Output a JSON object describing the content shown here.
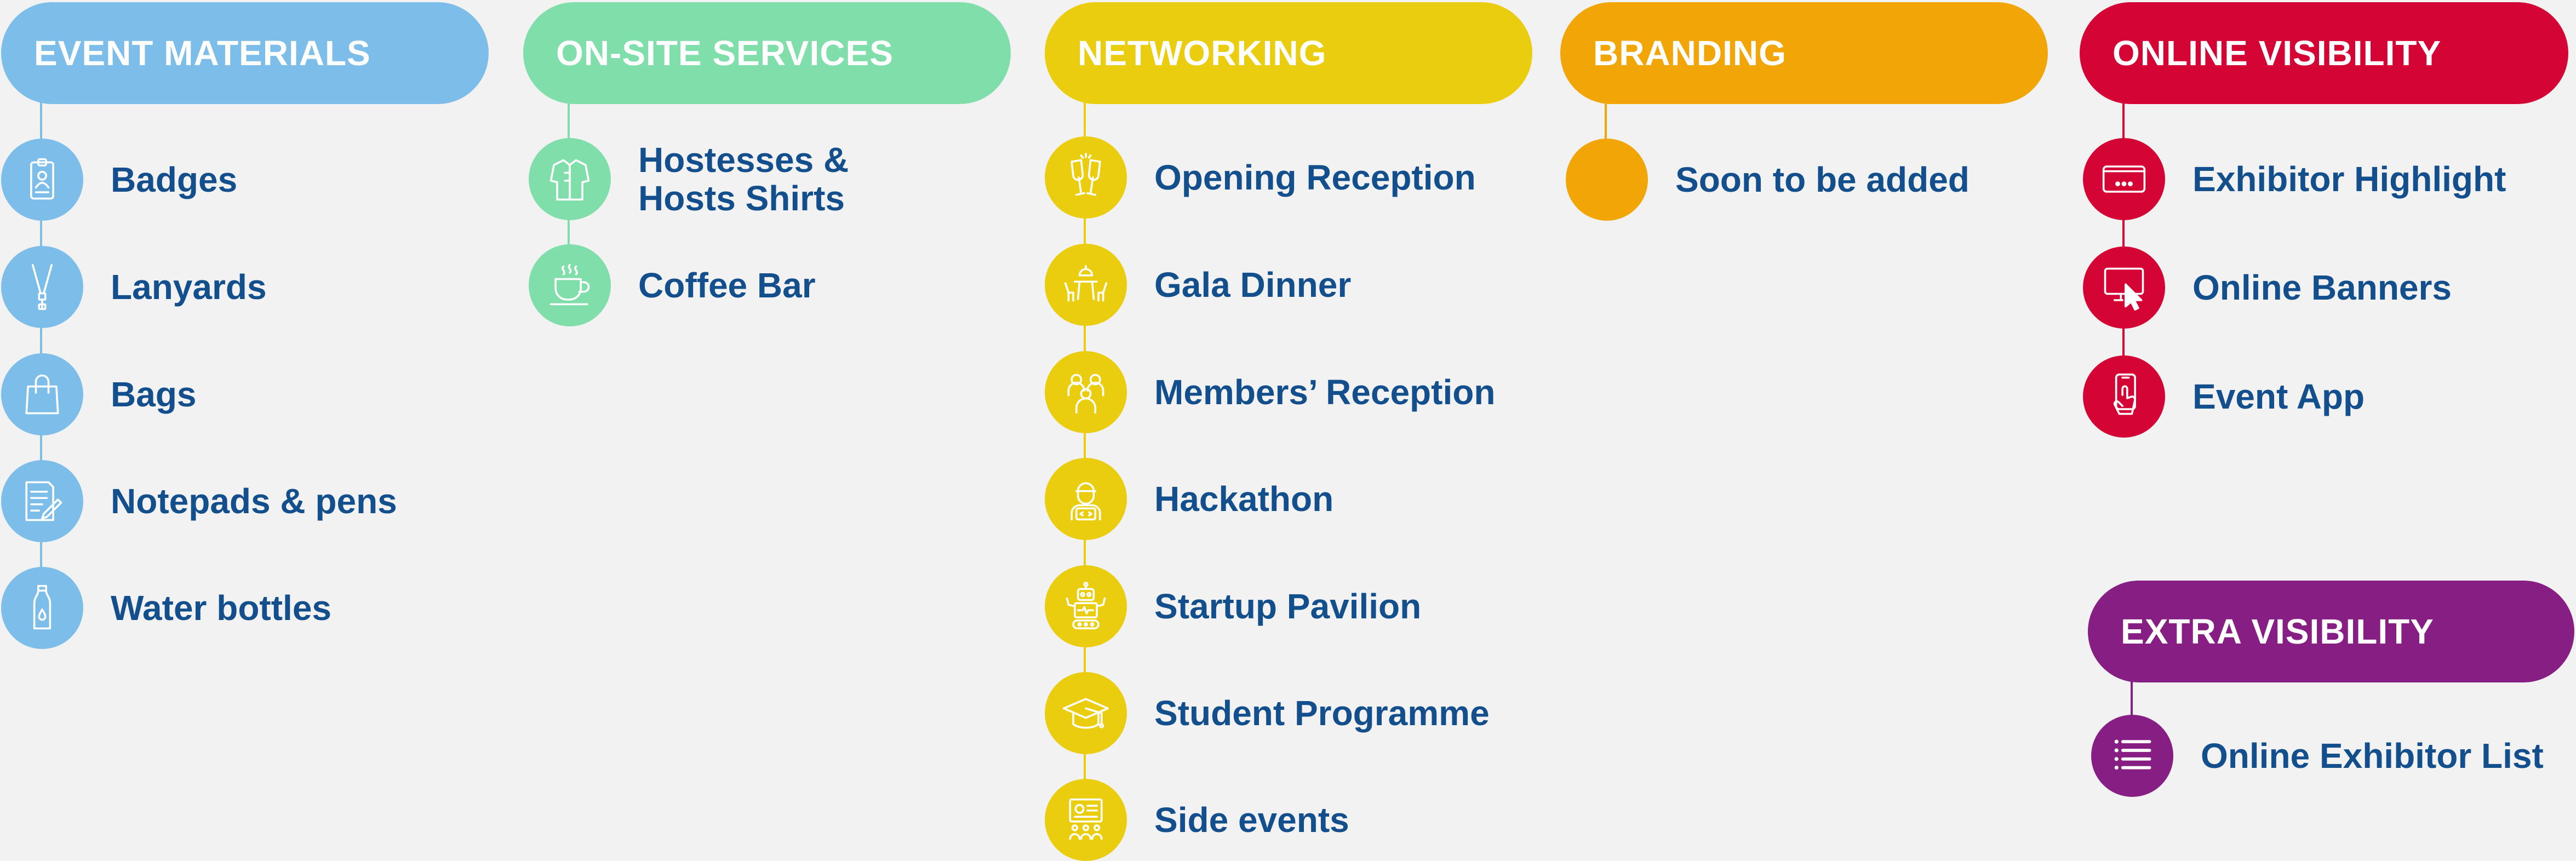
{
  "colors": {
    "event_materials": "#7dbde9",
    "on_site_services": "#80deab",
    "networking": "#ebcd10",
    "branding": "#f1a507",
    "online_visibility": "#d40535",
    "extra_visibility": "#861e83",
    "label_text": "#134f8c",
    "background": "#f2f2f2"
  },
  "event_materials": {
    "title": "EVENT MATERIALS",
    "items": [
      {
        "label": "Badges",
        "icon": "badge-icon"
      },
      {
        "label": "Lanyards",
        "icon": "lanyard-icon"
      },
      {
        "label": "Bags",
        "icon": "bag-icon"
      },
      {
        "label": "Notepads & pens",
        "icon": "notepad-pen-icon"
      },
      {
        "label": "Water bottles",
        "icon": "water-bottle-icon"
      }
    ]
  },
  "on_site_services": {
    "title": "ON-SITE SERVICES",
    "items": [
      {
        "label_line1": "Hostesses &",
        "label_line2": "Hosts Shirts",
        "icon": "shirt-icon"
      },
      {
        "label": "Coffee Bar",
        "icon": "coffee-cup-icon"
      }
    ]
  },
  "networking": {
    "title": "NETWORKING",
    "items": [
      {
        "label": "Opening Reception",
        "icon": "champagne-glasses-icon"
      },
      {
        "label": "Gala Dinner",
        "icon": "dinner-table-icon"
      },
      {
        "label": "Members’ Reception",
        "icon": "people-group-icon"
      },
      {
        "label": "Hackathon",
        "icon": "coder-icon"
      },
      {
        "label": "Startup Pavilion",
        "icon": "robot-icon"
      },
      {
        "label": "Student Programme",
        "icon": "graduation-cap-icon"
      },
      {
        "label": "Side events",
        "icon": "presentation-icon"
      }
    ]
  },
  "branding": {
    "title": "BRANDING",
    "items": [
      {
        "label": "Soon to be added"
      }
    ]
  },
  "online_visibility": {
    "title": "ONLINE VISIBILITY",
    "items": [
      {
        "label": "Exhibitor Highlight",
        "icon": "screen-dots-icon"
      },
      {
        "label": "Online Banners",
        "icon": "monitor-cursor-icon"
      },
      {
        "label": "Event App",
        "icon": "phone-tap-icon"
      }
    ]
  },
  "extra_visibility": {
    "title": "EXTRA VISIBILITY",
    "items": [
      {
        "label": "Online Exhibitor List",
        "icon": "list-icon"
      }
    ]
  }
}
